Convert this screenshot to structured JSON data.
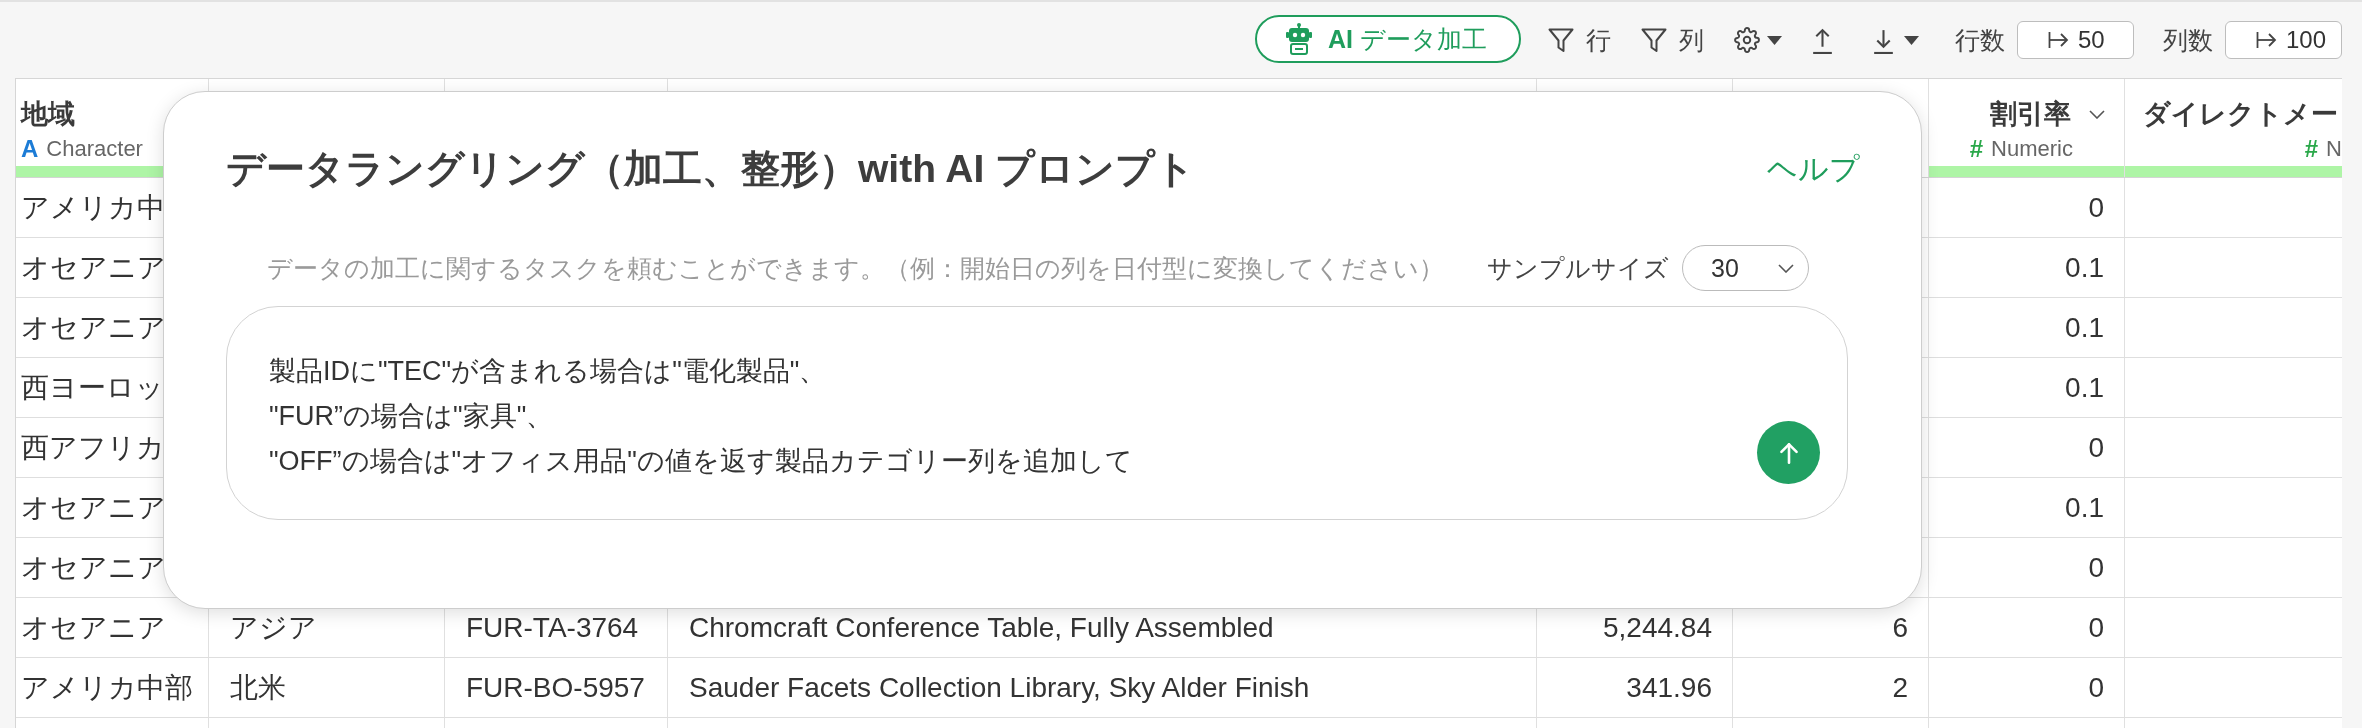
{
  "toolbar": {
    "ai_button": {
      "label": "**AI** データ加工"
    },
    "row_filter": {
      "label": "行"
    },
    "column_filter": {
      "label": "列"
    },
    "row_count": {
      "label": "行数",
      "value": "50"
    },
    "column_count": {
      "label": "列数",
      "value": "100"
    }
  },
  "table": {
    "columns": [
      {
        "title": "地域",
        "kind": "character",
        "type_icon": "A",
        "type": "Character",
        "dropdown": false
      },
      null,
      null,
      null,
      null,
      null,
      {
        "title": "割引率",
        "kind": "numeric",
        "type_icon": "#",
        "type": "Numeric",
        "dropdown": true
      },
      {
        "title": "ダイレクトメー",
        "kind": "numeric",
        "type_icon": "#",
        "type": "N",
        "dropdown": false
      }
    ],
    "rows": [
      {
        "cells": [
          "アメリカ中",
          null,
          null,
          null,
          null,
          null,
          "0"
        ]
      },
      {
        "cells": [
          "オセアニア",
          null,
          null,
          null,
          null,
          null,
          "0.1"
        ]
      },
      {
        "cells": [
          "オセアニア",
          null,
          null,
          null,
          null,
          null,
          "0.1"
        ]
      },
      {
        "cells": [
          "西ヨーロッ",
          null,
          null,
          null,
          null,
          null,
          "0.1"
        ]
      },
      {
        "cells": [
          "西アフリカ",
          null,
          null,
          null,
          null,
          null,
          "0"
        ]
      },
      {
        "cells": [
          "オセアニア",
          null,
          null,
          null,
          null,
          null,
          "0.1"
        ]
      },
      {
        "cells": [
          "オセアニア",
          null,
          null,
          null,
          null,
          null,
          "0"
        ]
      },
      {
        "cells": [
          "オセアニア",
          "アジア",
          "FUR-TA-3764",
          "Chromcraft Conference Table, Fully Assembled",
          "5,244.84",
          "6",
          "0"
        ]
      },
      {
        "cells": [
          "アメリカ中部",
          "北米",
          "FUR-BO-5957",
          "Sauder Facets Collection Library, Sky Alder Finish",
          "341.96",
          "2",
          "0"
        ]
      }
    ]
  },
  "dialog": {
    "title": "データラングリング（加工、整形）with AI プロンプト",
    "help_link": "ヘルプ",
    "description": "データの加工に関するタスクを頼むことができます。（例：開始日の列を日付型に変換してください）",
    "sample_size": {
      "label": "サンプルサイズ",
      "value": "30"
    },
    "prompt": {
      "value": "製品IDに\"TEC\"が含まれる場合は\"電化製品\"、\n\"FUR”の場合は\"家具\"、\n\"OFF”の場合は\"オフィス用品\"の値を返す製品カテゴリー列を追加して"
    }
  }
}
